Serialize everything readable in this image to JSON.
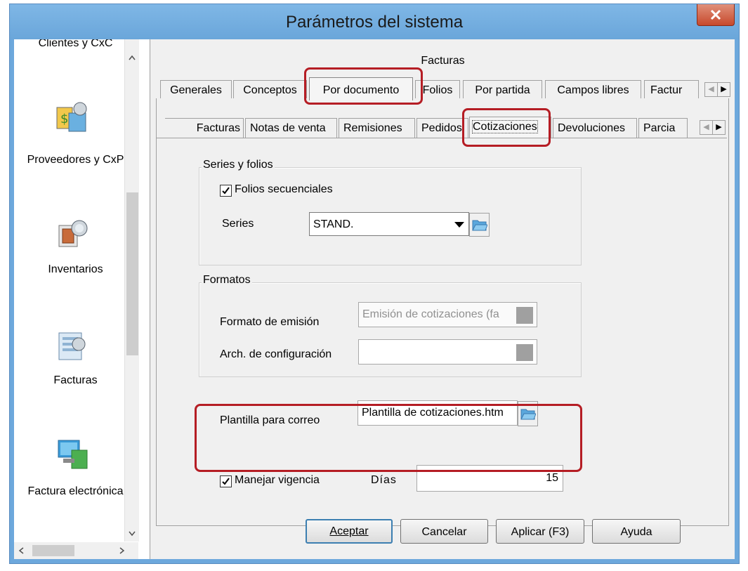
{
  "window": {
    "title": "Parámetros del sistema",
    "close_label": "x"
  },
  "sidebar": {
    "items": [
      {
        "label": "Clientes y CxC",
        "icon": "clients-icon"
      },
      {
        "label": "Proveedores y CxP",
        "icon": "suppliers-icon"
      },
      {
        "label": "Inventarios",
        "icon": "inventory-icon"
      },
      {
        "label": "Facturas",
        "icon": "invoices-icon"
      },
      {
        "label": "Factura electrónica",
        "icon": "e-invoice-icon"
      }
    ]
  },
  "main": {
    "section_title": "Facturas",
    "tabs": [
      "Generales",
      "Conceptos",
      "Por documento",
      "Folios",
      "Por partida",
      "Campos libres",
      "Factur"
    ],
    "selected_tab": "Por documento",
    "subtabs": [
      "Facturas",
      "Notas de venta",
      "Remisiones",
      "Pedidos",
      "Cotizaciones",
      "Devoluciones",
      "Parcia"
    ],
    "selected_subtab": "Cotizaciones"
  },
  "series_group": {
    "title": "Series y folios",
    "folios_checkbox_label": "Folios secuenciales",
    "folios_checked": true,
    "series_label": "Series",
    "series_value": "STAND."
  },
  "formatos_group": {
    "title": "Formatos",
    "emision_label": "Formato de emisión",
    "emision_value": "Emisión de cotizaciones (fa",
    "config_label": "Arch. de configuración",
    "config_value": ""
  },
  "plantilla": {
    "label": "Plantilla para correo",
    "value": "Plantilla de cotizaciones.htm"
  },
  "vigencia": {
    "checkbox_label": "Manejar vigencia",
    "checked": true,
    "dias_label": "Días",
    "dias_value": "15"
  },
  "buttons": {
    "accept": "Aceptar",
    "cancel": "Cancelar",
    "apply": "Aplicar (F3)",
    "help": "Ayuda"
  },
  "colors": {
    "title_bar": "#6da8dc",
    "highlight": "#b51d24",
    "close_button": "#c7492c"
  }
}
